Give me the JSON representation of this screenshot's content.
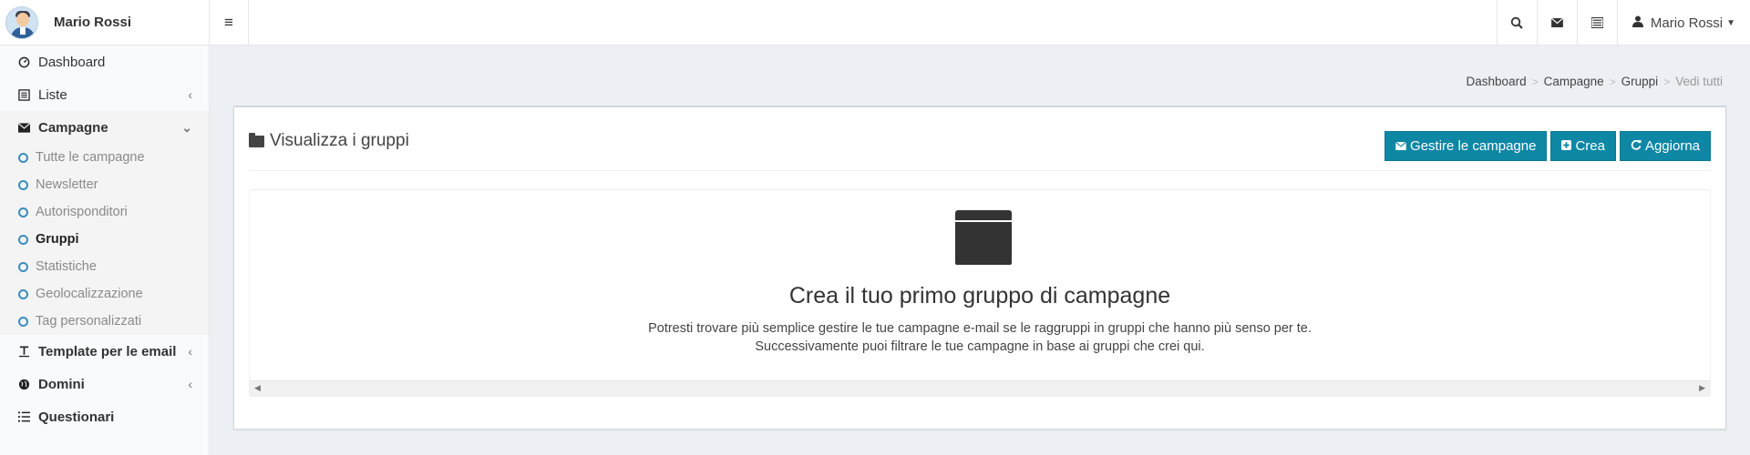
{
  "sidebar": {
    "user_name": "Mario Rossi",
    "items": [
      {
        "label": "Dashboard",
        "icon": "dashboard-icon"
      },
      {
        "label": "Liste",
        "icon": "list-icon"
      },
      {
        "label": "Campagne",
        "icon": "envelope-icon"
      },
      {
        "label": "Template per le email",
        "icon": "text-icon"
      },
      {
        "label": "Domini",
        "icon": "globe-icon"
      },
      {
        "label": "Questionari",
        "icon": "list-ul-icon"
      }
    ],
    "submenu": [
      "Tutte le campagne",
      "Newsletter",
      "Autorisponditori",
      "Gruppi",
      "Statistiche",
      "Geolocalizzazione",
      "Tag personalizzati"
    ]
  },
  "header": {
    "user_name": "Mario Rossi",
    "icons": [
      "menu-icon",
      "search-icon",
      "envelope-icon",
      "list-icon",
      "user-icon"
    ]
  },
  "breadcrumb": [
    "Dashboard",
    "Campagne",
    "Gruppi",
    "Vedi tutti"
  ],
  "box": {
    "title": "Visualizza i gruppi",
    "buttons": [
      "Gestire le campagne",
      "Crea",
      "Aggiorna"
    ],
    "empty_title": "Crea il tuo primo gruppo di campagne",
    "empty_line1": "Potresti trovare più semplice gestire le tue campagne e-mail se le raggruppi in gruppi che hanno più senso per te.",
    "empty_line2": "Successivamente puoi filtrare le tue campagne in base ai gruppi che crei qui."
  },
  "colors": {
    "accent": "#0e87a5",
    "bullet": "#3c8dbc"
  }
}
